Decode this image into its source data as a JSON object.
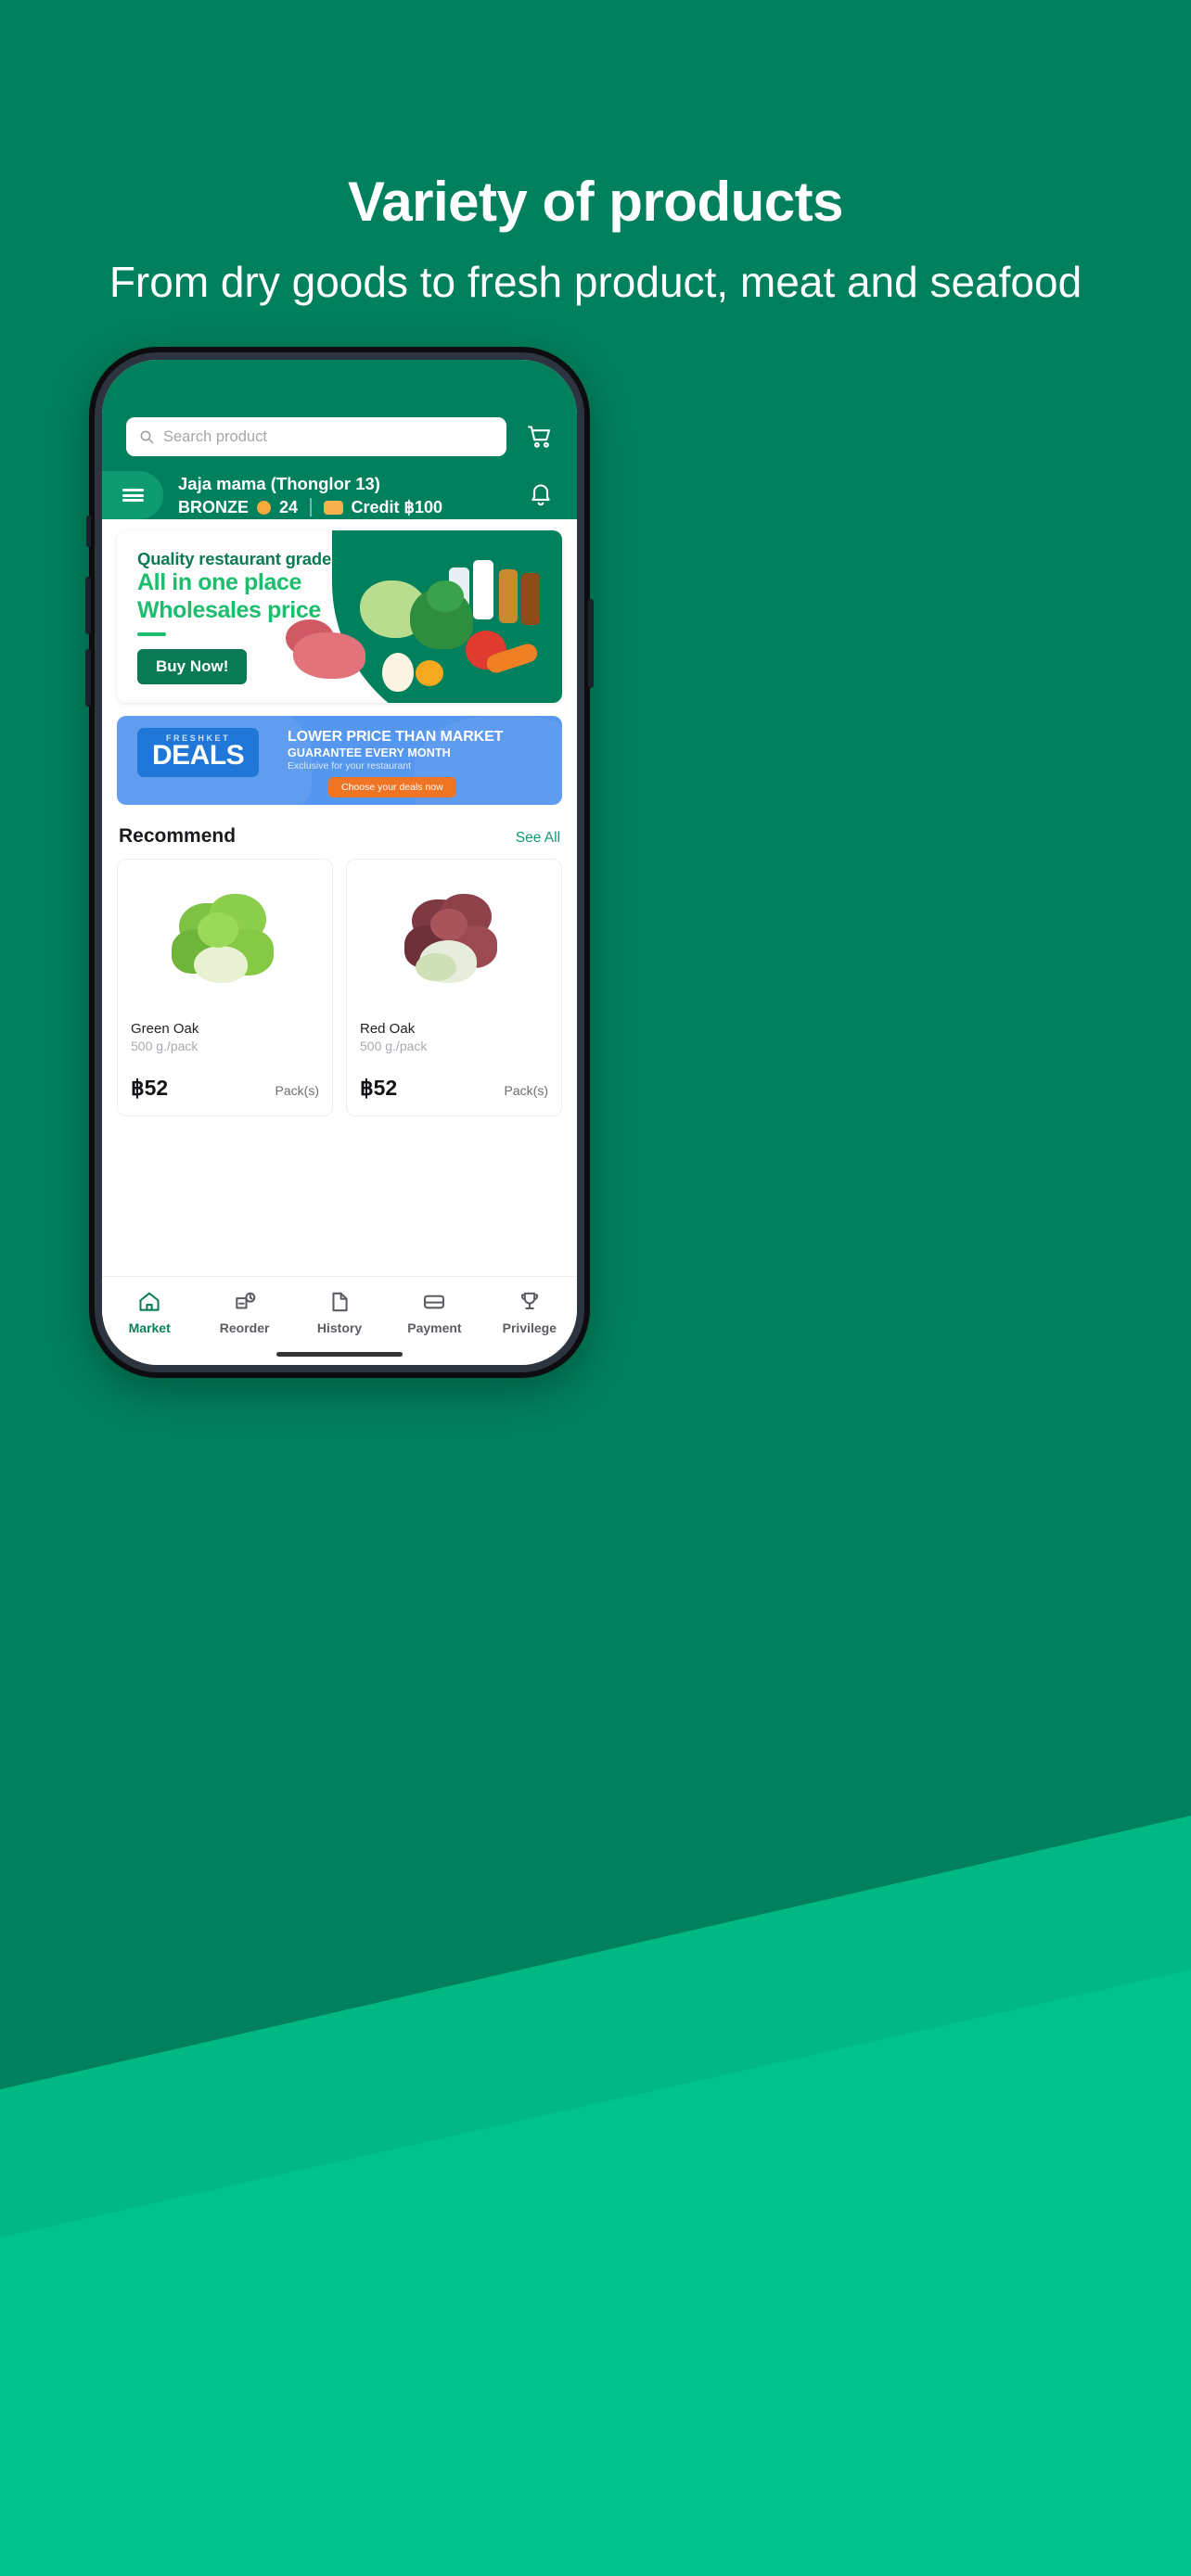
{
  "hero": {
    "headline": "Variety of products",
    "subheadline": "From dry goods to fresh product, meat and seafood"
  },
  "colors": {
    "brand_green": "#00805c",
    "accent_green": "#0e9b70",
    "light_green": "#1cbe6e",
    "deals_blue": "#5596ee",
    "deals_badge_blue": "#2177d8",
    "cta_orange": "#ef7423",
    "coin_orange": "#f7a93b"
  },
  "app": {
    "search": {
      "placeholder": "Search product",
      "icon": "search-icon"
    },
    "cart_icon": "shopping-cart-icon",
    "menu_icon": "hamburger-menu-icon",
    "bell_icon": "notification-bell-icon",
    "account": {
      "shop_name": "Jaja mama (Thonglor 13)",
      "tier": "BRONZE",
      "points": "24",
      "credit": "Credit ฿100"
    },
    "banner_promo": {
      "line1": "Quality restaurant grade",
      "line2": "All in one place",
      "line3": "Wholesales price",
      "cta": "Buy Now!"
    },
    "banner_deals": {
      "brand": "FRESHKET",
      "word": "DEALS",
      "line1": "LOWER PRICE THAN MARKET",
      "line2": "GUARANTEE EVERY MONTH",
      "line3": "Exclusive for your restaurant",
      "cta": "Choose your deals now"
    },
    "recommend": {
      "title": "Recommend",
      "see_all": "See All",
      "products": [
        {
          "name": "Green Oak",
          "unit": "500 g./pack",
          "price": "฿52",
          "uom": "Pack(s)",
          "image": "green-oak-lettuce-image"
        },
        {
          "name": "Red Oak",
          "unit": "500 g./pack",
          "price": "฿52",
          "uom": "Pack(s)",
          "image": "red-oak-lettuce-image"
        }
      ]
    },
    "bottom_nav": [
      {
        "label": "Market",
        "icon": "home-icon",
        "active": true
      },
      {
        "label": "Reorder",
        "icon": "reorder-clock-icon",
        "active": false
      },
      {
        "label": "History",
        "icon": "document-icon",
        "active": false
      },
      {
        "label": "Payment",
        "icon": "credit-card-icon",
        "active": false
      },
      {
        "label": "Privilege",
        "icon": "trophy-icon",
        "active": false
      }
    ]
  }
}
